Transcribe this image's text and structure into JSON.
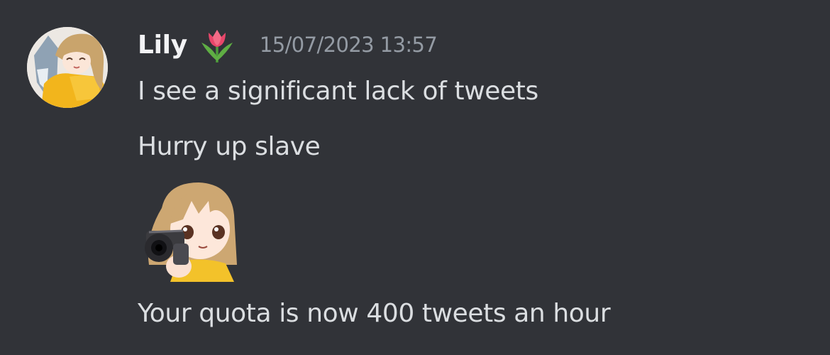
{
  "message": {
    "author": {
      "name": "Lily",
      "avatar_icon": "anime-girl-avatar-icon",
      "role_icon": "tulip-icon"
    },
    "timestamp": "15/07/2023 13:57",
    "lines": [
      "I see a significant lack of tweets",
      "Hurry up slave",
      "Your quota is now 400 tweets an hour"
    ],
    "custom_emoji": "anime-girl-pointing-gun-emoji"
  },
  "colors": {
    "background": "#313338",
    "username": "#f2f3f5",
    "timestamp": "#949ba4",
    "message_text": "#dbdee1"
  }
}
